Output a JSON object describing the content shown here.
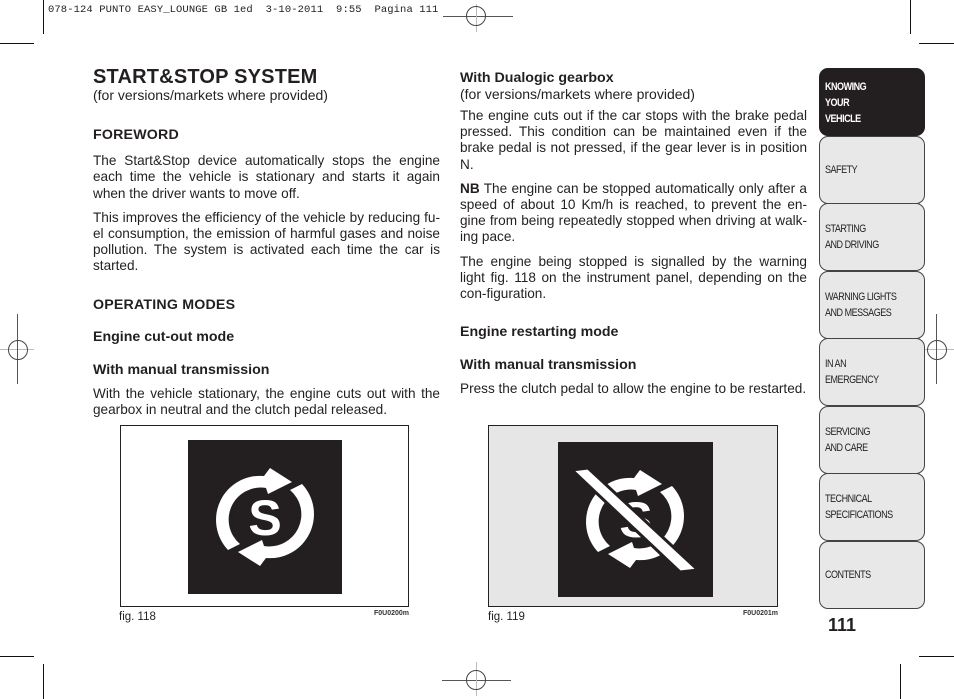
{
  "slug": "078-124 PUNTO EASY_LOUNGE GB 1ed  3-10-2011  9:55  Pagina 111",
  "left_column": {
    "title": "START&STOP SYSTEM",
    "subtitle": "(for versions/markets where provided)",
    "foreword_heading": "FOREWORD",
    "foreword_p1": "The Start&Stop device automatically stops the engine each time the vehicle is stationary and starts it again when the driver wants to move off.",
    "foreword_p2": "This improves the efficiency of the vehicle by reducing fu-el consumption, the emission of harmful gases and noise pollution. The system is activated each time the car is started.",
    "operating_heading": "OPERATING MODES",
    "cutout_heading": "Engine cut-out mode",
    "manual_heading": "With manual transmission",
    "manual_text": "With the vehicle stationary, the engine cuts out with the gearbox in neutral and the clutch pedal released."
  },
  "right_column": {
    "dualogic_heading": "With Dualogic gearbox",
    "dualogic_sub": "(for versions/markets where provided)",
    "dualogic_text": "The engine cuts out if the car stops with the brake pedal pressed. This condition can be maintained even if the brake pedal is not pressed, if the gear lever is in position N.",
    "nb_label": "NB",
    "nb_text": " The engine can be stopped automatically only after a speed of about 10 Km/h is reached, to prevent the en-gine from being repeatedly stopped when driving at walk-ing pace.",
    "signal_text": "The engine being stopped is signalled by the warning light fig. 118 on the instrument panel, depending on the con-figuration.",
    "restart_heading": "Engine restarting mode",
    "restart_manual_heading": "With manual transmission",
    "restart_text": "Press the clutch pedal to allow the engine to be restarted."
  },
  "figures": [
    {
      "caption": "fig. 118",
      "code": "F0U0200m",
      "icon": "start-stop-active-icon",
      "background": "#ffffff"
    },
    {
      "caption": "fig. 119",
      "code": "F0U0201m",
      "icon": "start-stop-disabled-icon",
      "background": "#e6e6e6"
    }
  ],
  "tabs": [
    {
      "label": "KNOWING\nYOUR\nVEHICLE",
      "active": true
    },
    {
      "label": "SAFETY",
      "active": false
    },
    {
      "label": "STARTING\nAND DRIVING",
      "active": false
    },
    {
      "label": "WARNING LIGHTS\nAND MESSAGES",
      "active": false
    },
    {
      "label": "IN AN\nEMERGENCY",
      "active": false
    },
    {
      "label": "SERVICING\nAND CARE",
      "active": false
    },
    {
      "label": "TECHNICAL\nSPECIFICATIONS",
      "active": false
    },
    {
      "label": "CONTENTS",
      "active": false
    }
  ],
  "page_number": "111"
}
